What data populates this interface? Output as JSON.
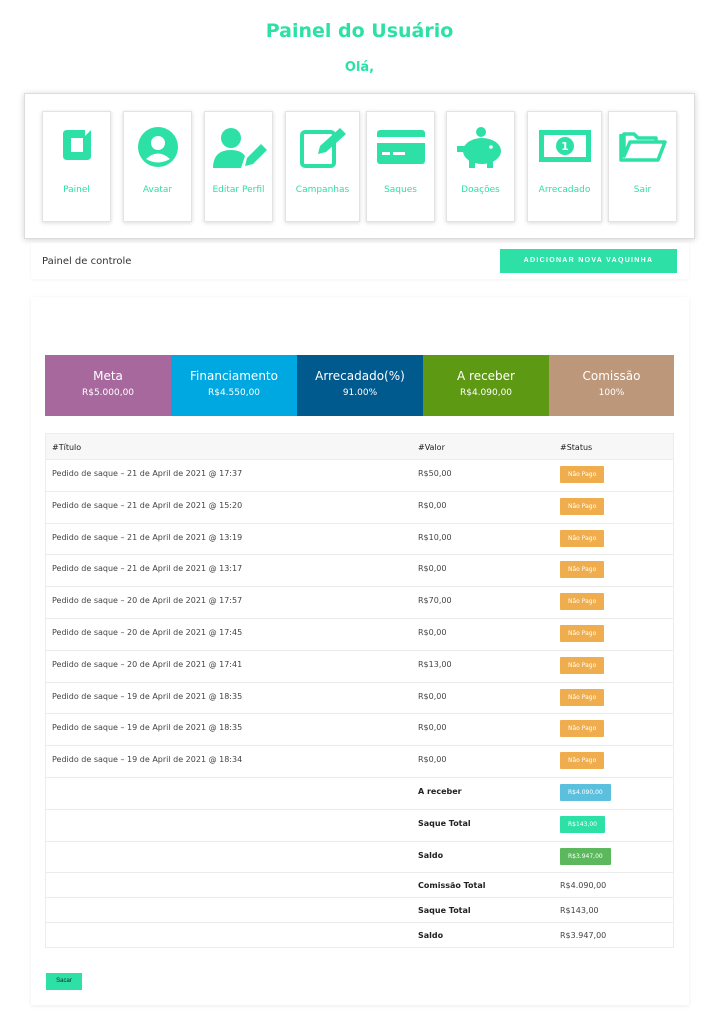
{
  "header": {
    "title": "Painel do Usuário",
    "greeting": "Olá,"
  },
  "menu": [
    {
      "label": "Painel",
      "icon": "dashboard-icon"
    },
    {
      "label": "Avatar",
      "icon": "user-circle-icon"
    },
    {
      "label": "Editar Perfil",
      "icon": "user-edit-icon"
    },
    {
      "label": "Campanhas",
      "icon": "edit-square-icon"
    },
    {
      "label": "Saques",
      "icon": "credit-card-icon"
    },
    {
      "label": "Doações",
      "icon": "piggy-bank-icon"
    },
    {
      "label": "Arrecadado",
      "icon": "money-bill-icon"
    },
    {
      "label": "Sair",
      "icon": "folder-open-icon"
    }
  ],
  "control": {
    "title": "Painel de controle",
    "add_label": "ADICIONAR NOVA VAQUINHA"
  },
  "stats": [
    {
      "title": "Meta",
      "value": "R$5.000,00",
      "color": "#a7689d"
    },
    {
      "title": "Financiamento",
      "value": "R$4.550,00",
      "color": "#00a8e1"
    },
    {
      "title": "Arrecadado(%)",
      "value": "91.00%",
      "color": "#005a8e"
    },
    {
      "title": "A receber",
      "value": "R$4.090,00",
      "color": "#5e9913"
    },
    {
      "title": "Comissão",
      "value": "100%",
      "color": "#bd977a"
    }
  ],
  "table": {
    "headers": [
      "#Título",
      "#Valor",
      "#Status"
    ],
    "rows": [
      {
        "title": "Pedido de saque – 21 de April de 2021 @ 17:37",
        "value": "R$50,00",
        "status": "Não Pago"
      },
      {
        "title": "Pedido de saque – 21 de April de 2021 @ 15:20",
        "value": "R$0,00",
        "status": "Não Pago"
      },
      {
        "title": "Pedido de saque – 21 de April de 2021 @ 13:19",
        "value": "R$10,00",
        "status": "Não Pago"
      },
      {
        "title": "Pedido de saque – 21 de April de 2021 @ 13:17",
        "value": "R$0,00",
        "status": "Não Pago"
      },
      {
        "title": "Pedido de saque – 20 de April de 2021 @ 17:57",
        "value": "R$70,00",
        "status": "Não Pago"
      },
      {
        "title": "Pedido de saque – 20 de April de 2021 @ 17:45",
        "value": "R$0,00",
        "status": "Não Pago"
      },
      {
        "title": "Pedido de saque – 20 de April de 2021 @ 17:41",
        "value": "R$13,00",
        "status": "Não Pago"
      },
      {
        "title": "Pedido de saque – 19 de April de 2021 @ 18:35",
        "value": "R$0,00",
        "status": "Não Pago"
      },
      {
        "title": "Pedido de saque – 19 de April de 2021 @ 18:35",
        "value": "R$0,00",
        "status": "Não Pago"
      },
      {
        "title": "Pedido de saque – 19 de April de 2021 @ 18:34",
        "value": "R$0,00",
        "status": "Não Pago"
      }
    ],
    "summary_badges": [
      {
        "label": "A receber",
        "value": "R$4.090,00",
        "color": "#5bc0de"
      },
      {
        "label": "Saque Total",
        "value": "R$143,00",
        "color": "#2de0a5"
      },
      {
        "label": "Saldo",
        "value": "R$3.947,00",
        "color": "#5cb85c"
      }
    ],
    "summary_plain": [
      {
        "label": "Comissão Total",
        "value": "R$4.090,00"
      },
      {
        "label": "Saque Total",
        "value": "R$143,00"
      },
      {
        "label": "Saldo",
        "value": "R$3.947,00"
      }
    ]
  },
  "sacar_label": "Sacar",
  "colors": {
    "accent": "#2de0a5",
    "unpaid": "#f0ad4e"
  }
}
